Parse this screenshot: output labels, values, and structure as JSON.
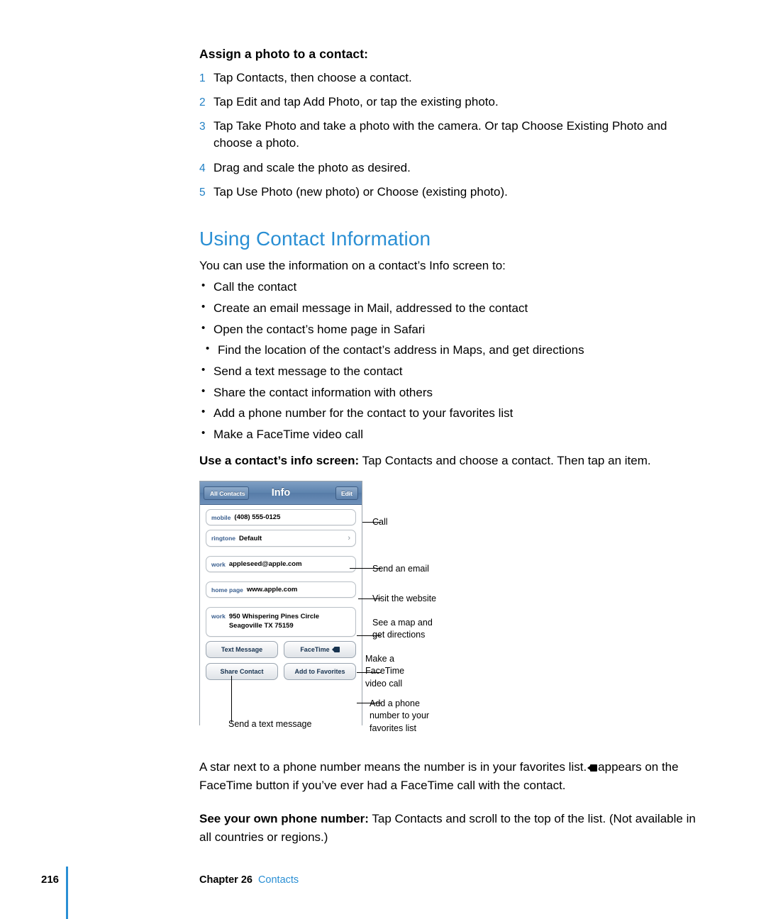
{
  "assign_photo": {
    "heading": "Assign a photo to a contact:",
    "steps": [
      {
        "num": "1",
        "text": "Tap Contacts, then choose a contact."
      },
      {
        "num": "2",
        "text": "Tap Edit and tap Add Photo, or tap the existing photo."
      },
      {
        "num": "3",
        "text": "Tap Take Photo and take a photo with the camera. Or tap Choose Existing Photo and choose a photo."
      },
      {
        "num": "4",
        "text": "Drag and scale the photo as desired."
      },
      {
        "num": "5",
        "text": "Tap Use Photo (new photo) or Choose (existing photo)."
      }
    ]
  },
  "section": {
    "title": "Using Contact Information",
    "intro": "You can use the information on a contact’s Info screen to:",
    "bullets": [
      "Call the contact",
      "Create an email message in Mail, addressed to the contact",
      "Open the contact’s home page in Safari",
      "Find the location of the contact’s address in Maps, and get directions",
      "Send a text message to the contact",
      "Share the contact information with others",
      "Add a phone number for the contact to your favorites list",
      "Make a FaceTime video call"
    ],
    "lead_bold": "Use a contact’s info screen:",
    "lead_rest": " Tap Contacts and choose a contact. Then tap an item."
  },
  "figure": {
    "nav": {
      "back_label": "All Contacts",
      "title": "Info",
      "edit_label": "Edit"
    },
    "rows": [
      {
        "label": "mobile",
        "value": "(408) 555-0125"
      },
      {
        "label": "ringtone",
        "value": "Default",
        "chevron": "›"
      },
      {
        "label": "work",
        "value": "appleseed@apple.com"
      },
      {
        "label": "home page",
        "value": "www.apple.com"
      },
      {
        "label": "work",
        "value": "950 Whispering Pines Circle\nSeagoville TX 75159"
      }
    ],
    "buttons": [
      "Text Message",
      "FaceTime",
      "Share Contact",
      "Add to Favorites"
    ],
    "callouts": [
      "Call",
      "Send an email",
      "Visit the website",
      "See a map and\nget directions",
      "Make a\nFaceTime\nvideo call",
      "Add a phone\nnumber to your\nfavorites list",
      "Send a text message"
    ]
  },
  "after_figure": {
    "part1": "A star next to a phone number means the number is in your favorites list.",
    "part2": "appears on the FaceTime button if you’ve ever had a FaceTime call with the contact.",
    "own_number_bold": "See your own phone number:",
    "own_number_rest": " Tap Contacts and scroll to the top of the list. (Not available in all countries or regions.)"
  },
  "footer": {
    "page_number": "216",
    "chapter": "Chapter 26",
    "chapter_title": "Contacts"
  }
}
